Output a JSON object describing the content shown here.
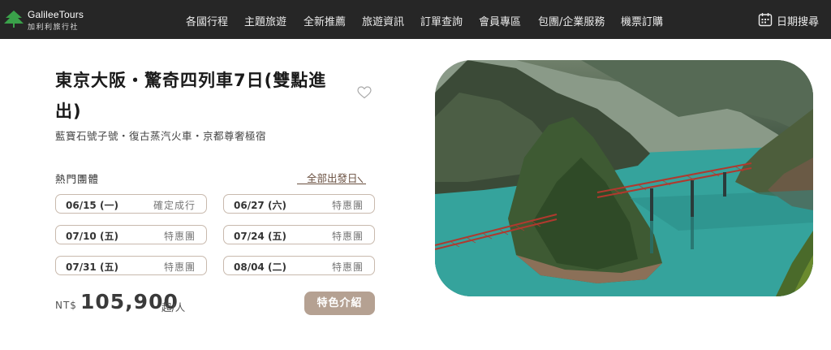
{
  "header": {
    "logo_text": "GalileeTours",
    "logo_subtext": "加利利旅行社",
    "nav": [
      {
        "label": "各國行程"
      },
      {
        "label": "主題旅遊"
      },
      {
        "label": "全新推薦"
      },
      {
        "label": "旅遊資訊"
      },
      {
        "label": "訂單查詢"
      },
      {
        "label": "會員專區"
      },
      {
        "label": "包團/企業服務"
      },
      {
        "label": "機票訂購"
      }
    ],
    "date_search": {
      "label": "日期搜尋",
      "icon": "calendar-icon"
    }
  },
  "tour": {
    "title": "東京大阪・驚奇四列車7日(雙點進出)",
    "subtitle": "藍寶石號子號・復古蒸汽火車・京都尊奢極宿",
    "favorite_icon": "heart-icon",
    "hot_label": "熱門團體",
    "all_dates_label": "全部出發日",
    "departures": [
      {
        "date": "06/15 (一)",
        "status": "確定成行"
      },
      {
        "date": "06/27 (六)",
        "status": "特惠團"
      },
      {
        "date": "07/10 (五)",
        "status": "特惠團"
      },
      {
        "date": "07/24 (五)",
        "status": "特惠團"
      },
      {
        "date": "07/31 (五)",
        "status": "特惠團"
      },
      {
        "date": "08/04 (二)",
        "status": "特惠團"
      }
    ],
    "price": {
      "currency": "NT$",
      "amount": "105,900",
      "unit": "起/人"
    },
    "feature_button": "特色介紹"
  },
  "colors": {
    "topbar": "#262626",
    "accent_brown": "#b5a192",
    "pill_border": "#c8b9ad",
    "logo_green": "#3aa14a"
  }
}
